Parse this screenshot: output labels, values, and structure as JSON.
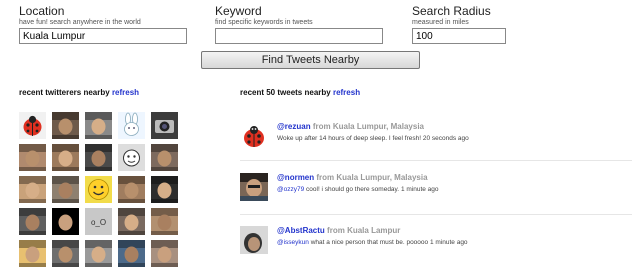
{
  "search": {
    "location": {
      "label": "Location",
      "hint": "have fun! search anywhere in the world",
      "value": "Kuala Lumpur"
    },
    "keyword": {
      "label": "Keyword",
      "hint": "find specific keywords in tweets",
      "value": ""
    },
    "radius": {
      "label": "Search Radius",
      "hint": "measured in miles",
      "value": "100"
    },
    "button_label": "Find Tweets Nearby"
  },
  "twitterers": {
    "title": "recent twitterers nearby",
    "refresh": "refresh",
    "avatars": [
      {
        "name": "ladybug-avatar",
        "icon": "ladybug-icon",
        "bg": "#f1f1f1"
      },
      {
        "name": "man-avatar",
        "icon": "person-photo",
        "bg": "#6e5a4a"
      },
      {
        "name": "man-avatar",
        "icon": "person-photo",
        "bg": "#8a8a8a"
      },
      {
        "name": "bunny-avatar",
        "icon": "bunny-icon",
        "bg": "#eef6ff"
      },
      {
        "name": "camera-avatar",
        "icon": "camera-icon",
        "bg": "#3c3c3c"
      },
      {
        "name": "man-avatar",
        "icon": "person-photo",
        "bg": "#b08a6e"
      },
      {
        "name": "man-avatar",
        "icon": "person-photo",
        "bg": "#9c7a5c"
      },
      {
        "name": "man-avatar",
        "icon": "person-photo",
        "bg": "#4a4a4a"
      },
      {
        "name": "cartoon-avatar",
        "icon": "cartoon-icon",
        "bg": "#dddddd"
      },
      {
        "name": "man-avatar",
        "icon": "person-photo",
        "bg": "#7d6a5e"
      },
      {
        "name": "man-avatar",
        "icon": "person-photo",
        "bg": "#c9a27a"
      },
      {
        "name": "man-avatar",
        "icon": "person-photo",
        "bg": "#8e8070"
      },
      {
        "name": "smiley-avatar",
        "icon": "smiley-icon",
        "bg": "#f2dc4a"
      },
      {
        "name": "man-avatar",
        "icon": "person-photo",
        "bg": "#a07d5f"
      },
      {
        "name": "man-avatar",
        "icon": "person-photo",
        "bg": "#2d2d2d"
      },
      {
        "name": "man-avatar",
        "icon": "person-photo",
        "bg": "#5f5f5f"
      },
      {
        "name": "man-avatar",
        "icon": "person-photo",
        "bg": "#000000"
      },
      {
        "name": "oo-avatar",
        "icon": "text-face-icon",
        "bg": "#c8c8c8",
        "text": "o_O"
      },
      {
        "name": "man-avatar",
        "icon": "person-photo",
        "bg": "#7a6a60"
      },
      {
        "name": "man-avatar",
        "icon": "person-photo",
        "bg": "#b29070"
      },
      {
        "name": "man-avatar",
        "icon": "person-photo",
        "bg": "#e8c070"
      },
      {
        "name": "man-avatar",
        "icon": "person-photo",
        "bg": "#6e6e6e"
      },
      {
        "name": "man-avatar",
        "icon": "person-photo",
        "bg": "#9a9a9a"
      },
      {
        "name": "man-avatar",
        "icon": "person-photo",
        "bg": "#4c6a8a"
      },
      {
        "name": "man-avatar",
        "icon": "person-photo",
        "bg": "#a89080"
      }
    ]
  },
  "tweets": {
    "title": "recent 50 tweets nearby",
    "refresh": "refresh",
    "items": [
      {
        "user": "@rezuan",
        "from_label": "from",
        "location": "Kuala Lumpur, Malaysia",
        "mention": "",
        "text": "Woke up after 14 hours of deep sleep. I feel fresh!",
        "time": "20 seconds ago",
        "avatar": "ladybug"
      },
      {
        "user": "@normen",
        "from_label": "from",
        "location": "Kuala Lumpur, Malaysia",
        "mention": "@ozzy79",
        "text": "cool! i should go there someday.",
        "time": "1 minute ago",
        "avatar": "person"
      },
      {
        "user": "@AbstRactu",
        "from_label": "from",
        "location": "Kuala Lampur",
        "mention": "@isseykun",
        "text": "what a nice person that must be. pooooo",
        "time": "1 minute ago",
        "avatar": "person"
      }
    ]
  },
  "colors": {
    "link": "#2233cc",
    "muted": "#999999"
  }
}
